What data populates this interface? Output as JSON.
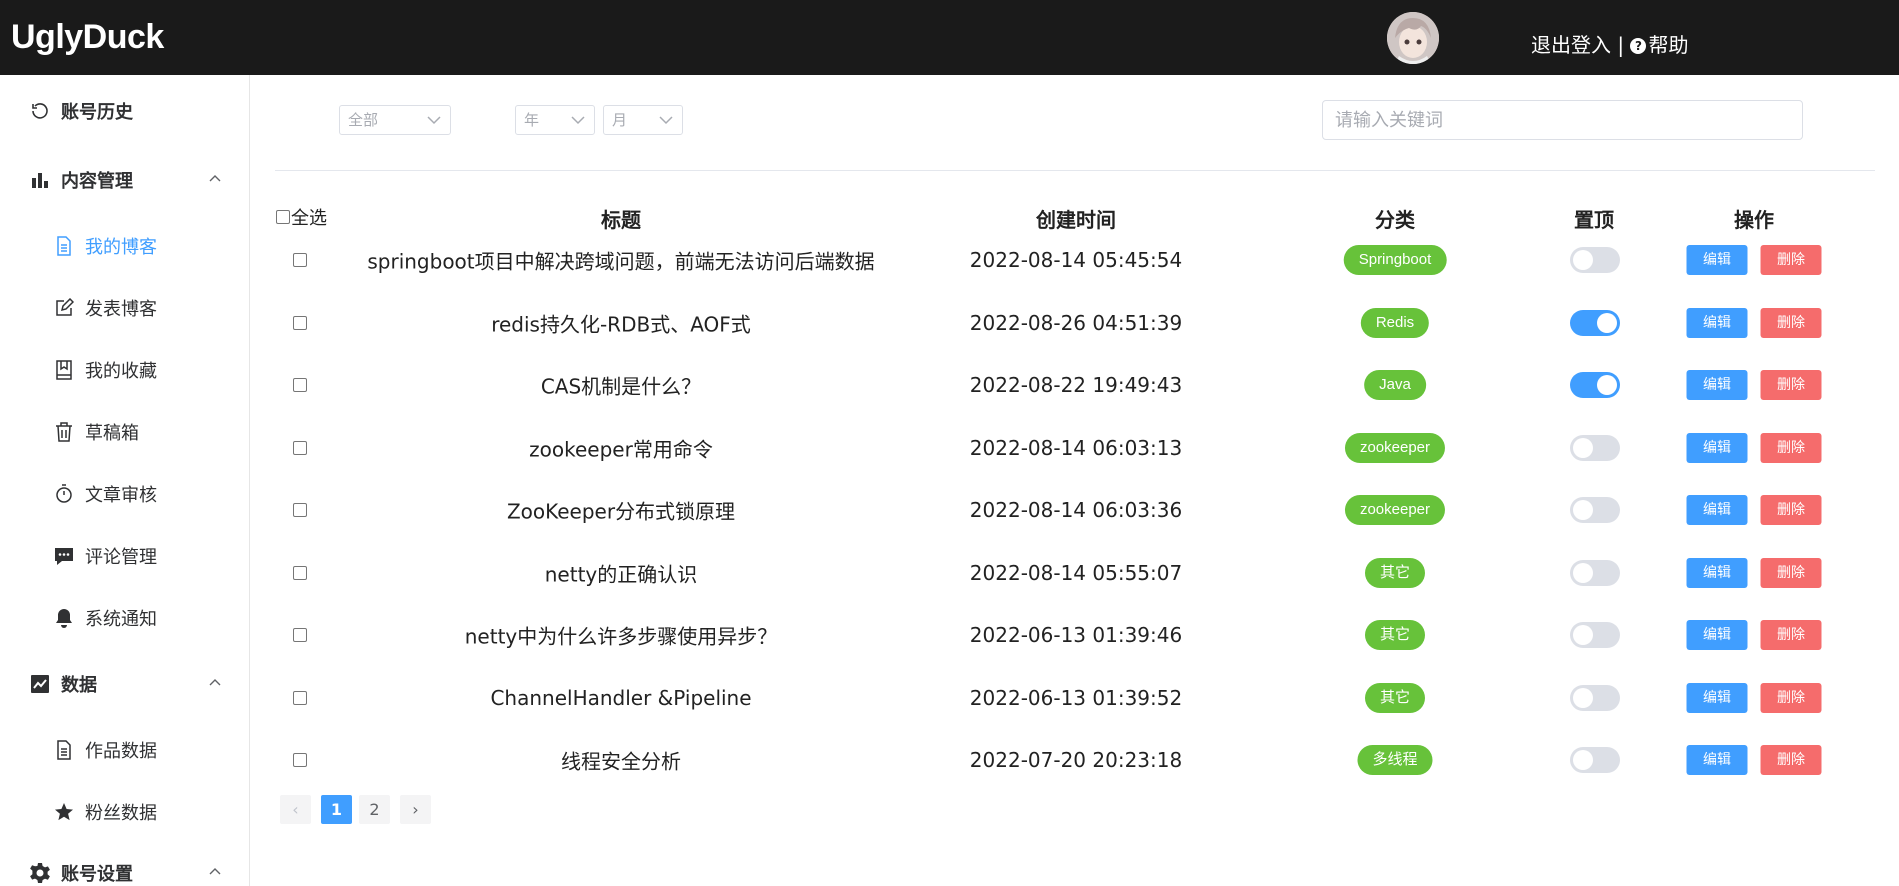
{
  "header": {
    "logo": "UglyDuck",
    "logout": "退出登入",
    "separator": "|",
    "help": "帮助"
  },
  "sidebar": {
    "items": [
      {
        "label": "账号历史",
        "icon": "history-icon",
        "group": true
      },
      {
        "label": "内容管理",
        "icon": "bar-chart-icon",
        "group": true,
        "expanded": true
      },
      {
        "label": "我的博客",
        "icon": "document-icon",
        "active": true
      },
      {
        "label": "发表博客",
        "icon": "edit-icon"
      },
      {
        "label": "我的收藏",
        "icon": "bookmark-icon"
      },
      {
        "label": "草稿箱",
        "icon": "trash-icon"
      },
      {
        "label": "文章审核",
        "icon": "timer-icon"
      },
      {
        "label": "评论管理",
        "icon": "comment-icon"
      },
      {
        "label": "系统通知",
        "icon": "bell-icon"
      },
      {
        "label": "数据",
        "icon": "trend-chart-icon",
        "group": true,
        "expanded": true
      },
      {
        "label": "作品数据",
        "icon": "document-icon"
      },
      {
        "label": "粉丝数据",
        "icon": "star-icon"
      },
      {
        "label": "账号设置",
        "icon": "gear-icon",
        "group": true,
        "expanded": true
      }
    ]
  },
  "filters": {
    "category": "全部",
    "year": "年",
    "month": "月",
    "search_placeholder": "请输入关键词"
  },
  "table": {
    "select_all": "全选",
    "columns": [
      "标题",
      "创建时间",
      "分类",
      "置顶",
      "操作"
    ],
    "edit_label": "编辑",
    "delete_label": "删除",
    "rows": [
      {
        "title": "springboot项目中解决跨域问题，前端无法访问后端数据",
        "time": "2022-08-14 05:45:54",
        "category": "Springboot",
        "pinned": false
      },
      {
        "title": "redis持久化-RDB式、AOF式",
        "time": "2022-08-26 04:51:39",
        "category": "Redis",
        "pinned": true
      },
      {
        "title": "CAS机制是什么？",
        "time": "2022-08-22 19:49:43",
        "category": "Java",
        "pinned": true
      },
      {
        "title": "zookeeper常用命令",
        "time": "2022-08-14 06:03:13",
        "category": "zookeeper",
        "pinned": false
      },
      {
        "title": "ZooKeeper分布式锁原理",
        "time": "2022-08-14 06:03:36",
        "category": "zookeeper",
        "pinned": false
      },
      {
        "title": "netty的正确认识",
        "time": "2022-08-14 05:55:07",
        "category": "其它",
        "pinned": false
      },
      {
        "title": "netty中为什么许多步骤使用异步？",
        "time": "2022-06-13 01:39:46",
        "category": "其它",
        "pinned": false
      },
      {
        "title": "ChannelHandler &Pipeline",
        "time": "2022-06-13 01:39:52",
        "category": "其它",
        "pinned": false
      },
      {
        "title": "线程安全分析",
        "time": "2022-07-20 20:23:18",
        "category": "多线程",
        "pinned": false
      }
    ]
  },
  "pagination": {
    "prev": "‹",
    "pages": [
      "1",
      "2"
    ],
    "current": "1",
    "next": "›"
  },
  "colors": {
    "primary": "#409eff",
    "success": "#67c23a",
    "danger": "#f56c6c",
    "header_bg": "#1a1a1a"
  }
}
